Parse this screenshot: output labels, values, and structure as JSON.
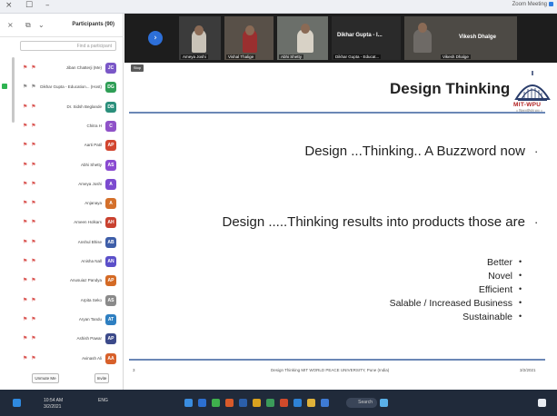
{
  "window": {
    "controls": [
      "×",
      "☐",
      "–"
    ],
    "recording_label": "Zoom Meeting"
  },
  "participants_panel": {
    "title": "Participants (90)",
    "search_placeholder": "Find a participant",
    "participants": [
      {
        "name": "Jiban Chatterji (Me)",
        "initials": "JC",
        "color": "#7a57c7",
        "icons": "⚑ ⚑",
        "host": false
      },
      {
        "name": "Dikhar Gupta - Education... (Host)",
        "initials": "DG",
        "color": "#2f9e56",
        "icons": "⚑ ⚑",
        "host": true
      },
      {
        "name": "Dr. Sidsh Beglande",
        "initials": "DB",
        "color": "#2b8f7b",
        "icons": "⚑ ⚑",
        "host": false
      },
      {
        "name": "Chitra H",
        "initials": "C",
        "color": "#8f52c8",
        "icons": "⚑ ⚑",
        "host": false
      },
      {
        "name": "Aarti Patil",
        "initials": "AP",
        "color": "#d2452f",
        "icons": "⚑ ⚑",
        "host": false
      },
      {
        "name": "Abhi Shetty",
        "initials": "AS",
        "color": "#8a4ad1",
        "icons": "⚑ ⚑",
        "host": false
      },
      {
        "name": "Ameya Joshi",
        "initials": "A",
        "color": "#7c4bd0",
        "icons": "⚑ ⚑",
        "host": false
      },
      {
        "name": "Anjanaya",
        "initials": "A",
        "color": "#d4702b",
        "icons": "⚑ ⚑",
        "host": false
      },
      {
        "name": "Ameen Holkars",
        "initials": "AH",
        "color": "#c9412f",
        "icons": "⚑ ⚑",
        "host": false
      },
      {
        "name": "Anshul Bhise",
        "initials": "AB",
        "color": "#3e5ea8",
        "icons": "⚑ ⚑",
        "host": false
      },
      {
        "name": "Anisha Nall",
        "initials": "AN",
        "color": "#5b4fc9",
        "icons": "⚑ ⚑",
        "host": false
      },
      {
        "name": "Anusuiaz Pandya",
        "initials": "AP",
        "color": "#d46a25",
        "icons": "⚑ ⚑",
        "host": false
      },
      {
        "name": "Arpita Seko",
        "initials": "AS",
        "color": "#8a8a8a",
        "icons": "⚑ ⚑",
        "host": false
      },
      {
        "name": "Aryan Tandu",
        "initials": "AT",
        "color": "#2e7fc1",
        "icons": "⚑ ⚑",
        "host": false
      },
      {
        "name": "Ashish Pawar",
        "initials": "AP",
        "color": "#3c4a8a",
        "icons": "⚑ ⚑",
        "host": false
      },
      {
        "name": "Avinash Ali",
        "initials": "AA",
        "color": "#d7602a",
        "icons": "⚑ ⚑",
        "host": false
      }
    ],
    "invite_label": "Invite",
    "mute_all_label": "Unmute Me"
  },
  "video_strip": {
    "next_icon": "›",
    "tiles": [
      {
        "name": "Vikesh Dhalge",
        "kind": "person"
      },
      {
        "name": "Dikhar Gupta - I...",
        "kind": "name",
        "subname": "Dikhar Gupta - Educat..."
      },
      {
        "name": "Abhi Shetty",
        "kind": "person"
      },
      {
        "name": "Vishal Thalige",
        "kind": "person"
      },
      {
        "name": "Ameya Joshi",
        "kind": "person"
      }
    ]
  },
  "slide": {
    "title": "Design Thinking",
    "logo_text": "MIT-WPU",
    "logo_sub": "॥ विश्वशांतिर्ध्रुवं ध्रुवा ॥",
    "bullets": [
      "Design ...Thinking.. A Buzzword now",
      "Design .....Thinking results into products those are"
    ],
    "sub_bullets": [
      "Better",
      "Novel",
      "Efficient",
      "Salable / Increased Business",
      "Sustainable"
    ],
    "footer_left": "3/2/2021",
    "footer_center": "Design Thinking  MIT WORLD PEACE UNIVERSITY, Pune (India)",
    "footer_right": "3"
  },
  "share_toolbar": {
    "button_label": "Stop"
  },
  "taskbar": {
    "search_label": "Search",
    "time": "10:54 AM",
    "date": "3/2/2021",
    "lang": "ENG"
  }
}
